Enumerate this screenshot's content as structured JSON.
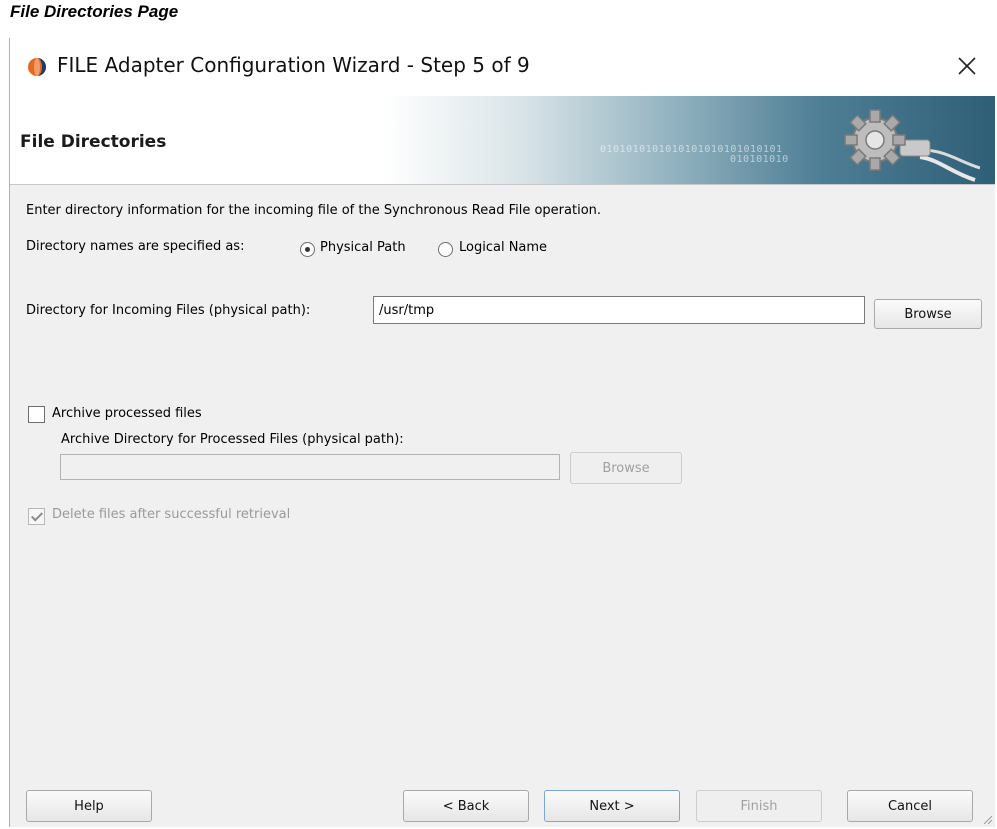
{
  "page_caption": "File Directories Page",
  "window": {
    "title": "FILE Adapter Configuration Wizard - Step 5 of 9"
  },
  "banner": {
    "title": "File Directories",
    "binary_line1": "0101010101010101010101010101",
    "binary_line2": "010101010"
  },
  "content": {
    "intro": "Enter directory information for the incoming file of the Synchronous Read File operation.",
    "dirnames_label": "Directory names are specified as:",
    "radio_physical": "Physical Path",
    "radio_logical": "Logical Name",
    "radio_selected": "Physical Path",
    "incoming_label": "Directory for Incoming Files (physical path):",
    "incoming_value": "/usr/tmp",
    "browse_label": "Browse",
    "archive_checkbox_label": "Archive processed files",
    "archive_checked": false,
    "archive_dir_label": "Archive Directory for Processed Files (physical path):",
    "archive_dir_value": "",
    "archive_browse_label": "Browse",
    "delete_label": "Delete files after successful retrieval",
    "delete_checked": true
  },
  "footer": {
    "help": "Help",
    "back": "< Back",
    "next": "Next >",
    "finish": "Finish",
    "cancel": "Cancel"
  },
  "colors": {
    "window_bg": "#f0f0f0",
    "banner_dark": "#2f5f77",
    "disabled_text": "#a0a0a0"
  }
}
